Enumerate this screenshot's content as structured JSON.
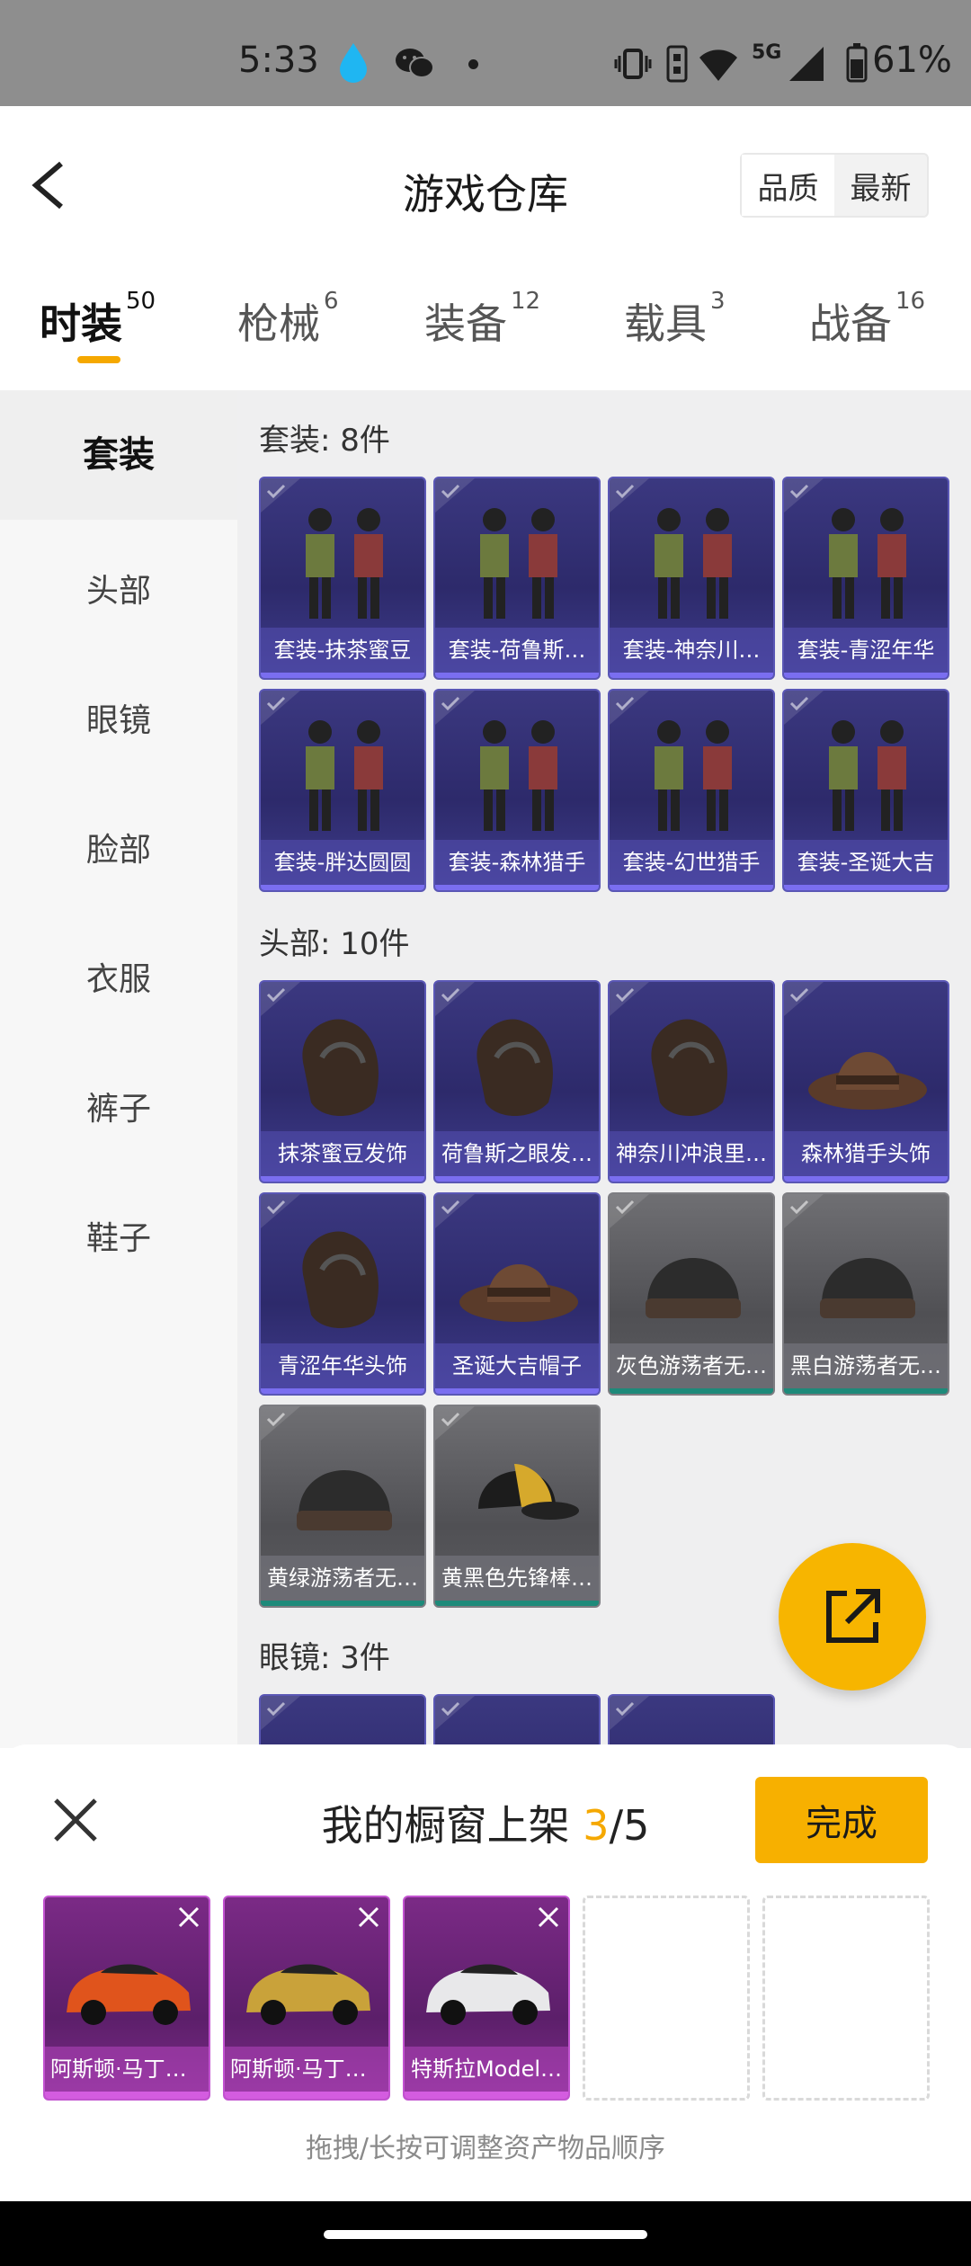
{
  "status_bar": {
    "time": "5:33",
    "network": "5G",
    "battery": "61%",
    "icons": [
      "drop-icon",
      "wechat-icon",
      "dot-icon",
      "vibrate-icon",
      "sim-icon",
      "wifi-icon",
      "signal-icon",
      "battery-icon"
    ]
  },
  "header": {
    "title": "游戏仓库",
    "sort_options": [
      "品质",
      "最新"
    ],
    "active_sort": "品质"
  },
  "tabs": [
    {
      "label": "时装",
      "count": "50",
      "active": true
    },
    {
      "label": "枪械",
      "count": "6",
      "active": false
    },
    {
      "label": "装备",
      "count": "12",
      "active": false
    },
    {
      "label": "载具",
      "count": "3",
      "active": false
    },
    {
      "label": "战备",
      "count": "16",
      "active": false
    }
  ],
  "accent_color": "#f5a800",
  "side_nav": {
    "items": [
      "套装",
      "头部",
      "眼镜",
      "脸部",
      "衣服",
      "裤子",
      "鞋子"
    ],
    "active": "套装"
  },
  "sections": [
    {
      "title": "套装: 8件",
      "items": [
        {
          "label": "套装-抹茶蜜豆",
          "rarity": "purple",
          "icon": "outfit-icon"
        },
        {
          "label": "套装-荷鲁斯…",
          "rarity": "purple",
          "icon": "outfit-icon"
        },
        {
          "label": "套装-神奈川…",
          "rarity": "purple",
          "icon": "outfit-icon"
        },
        {
          "label": "套装-青涩年华",
          "rarity": "purple",
          "icon": "outfit-icon"
        },
        {
          "label": "套装-胖达圆圆",
          "rarity": "purple",
          "icon": "outfit-icon"
        },
        {
          "label": "套装-森林猎手",
          "rarity": "purple",
          "icon": "outfit-icon"
        },
        {
          "label": "套装-幻世猎手",
          "rarity": "purple",
          "icon": "outfit-icon"
        },
        {
          "label": "套装-圣诞大吉",
          "rarity": "purple",
          "icon": "outfit-icon"
        }
      ]
    },
    {
      "title": "头部: 10件",
      "items": [
        {
          "label": "抹茶蜜豆发饰",
          "rarity": "purple",
          "icon": "hair-icon"
        },
        {
          "label": "荷鲁斯之眼发…",
          "rarity": "purple",
          "icon": "hair-icon"
        },
        {
          "label": "神奈川冲浪里…",
          "rarity": "purple",
          "icon": "hair-icon"
        },
        {
          "label": "森林猎手头饰",
          "rarity": "purple",
          "icon": "hat-icon"
        },
        {
          "label": "青涩年华头饰",
          "rarity": "purple",
          "icon": "hair-icon"
        },
        {
          "label": "圣诞大吉帽子",
          "rarity": "purple",
          "icon": "hat-icon"
        },
        {
          "label": "灰色游荡者无…",
          "rarity": "gray",
          "icon": "beanie-icon"
        },
        {
          "label": "黑白游荡者无…",
          "rarity": "gray",
          "icon": "beanie-icon"
        },
        {
          "label": "黄绿游荡者无…",
          "rarity": "gray",
          "icon": "beanie-icon"
        },
        {
          "label": "黄黑色先锋棒…",
          "rarity": "gray",
          "icon": "cap-icon"
        }
      ]
    },
    {
      "title": "眼镜: 3件",
      "items": [
        {
          "label": "",
          "rarity": "purple",
          "icon": "glasses-icon"
        },
        {
          "label": "",
          "rarity": "purple",
          "icon": "glasses-icon"
        },
        {
          "label": "",
          "rarity": "purple",
          "icon": "glasses-icon"
        }
      ]
    }
  ],
  "fab": {
    "icon": "share-icon"
  },
  "sheet": {
    "title_prefix": "我的橱窗上架 ",
    "count_current": "3",
    "count_sep": "/",
    "count_total": "5",
    "done_label": "完成",
    "slots": [
      {
        "label": "阿斯顿·马丁D…",
        "filled": true,
        "icon": "car-icon",
        "car_color": "#e0541c"
      },
      {
        "label": "阿斯顿·马丁D…",
        "filled": true,
        "icon": "car-icon",
        "car_color": "#c9a23a"
      },
      {
        "label": "特斯拉Model…",
        "filled": true,
        "icon": "car-icon",
        "car_color": "#e8e8ea"
      },
      {
        "label": "",
        "filled": false
      },
      {
        "label": "",
        "filled": false
      }
    ],
    "hint": "拖拽/长按可调整资产物品顺序"
  }
}
